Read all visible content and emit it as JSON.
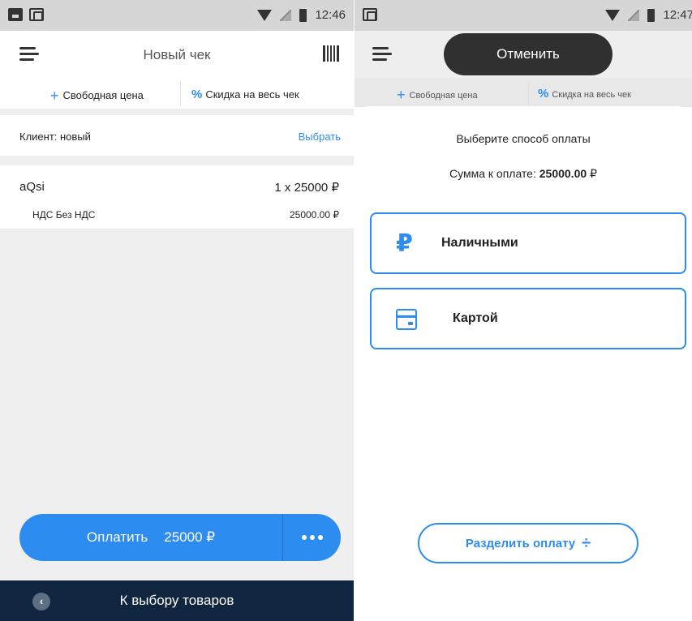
{
  "left": {
    "statusbar": {
      "time": "12:46"
    },
    "header": {
      "title": "Новый чек"
    },
    "actions": {
      "free_price": "Свободная цена",
      "discount": "Скидка на весь чек"
    },
    "client": {
      "label": "Клиент: новый",
      "select": "Выбрать"
    },
    "item": {
      "name": "aQsi",
      "qty_price": "1 x 25000 ₽",
      "tax_label": "НДС Без НДС",
      "tax_value": "25000.00 ₽"
    },
    "pay": {
      "label": "Оплатить",
      "amount": "25000 ₽"
    },
    "bottom": {
      "back_label": "К выбору товаров"
    }
  },
  "right": {
    "statusbar": {
      "time": "12:47"
    },
    "cancel_label": "Отменить",
    "actions": {
      "free_price": "Свободная цена",
      "discount": "Скидка на весь чек"
    },
    "sheet": {
      "choose_text": "Выберите способ оплаты",
      "sum_label": "Сумма к оплате:",
      "sum_value": "25000.00",
      "sum_currency": "₽",
      "options": [
        {
          "label": "Наличными",
          "icon": "ruble-icon"
        },
        {
          "label": "Картой",
          "icon": "card-icon"
        }
      ],
      "split_label": "Разделить оплату"
    }
  },
  "colors": {
    "accent": "#2d8cf0",
    "bottombar": "#10263f",
    "dark_button": "#303030"
  }
}
